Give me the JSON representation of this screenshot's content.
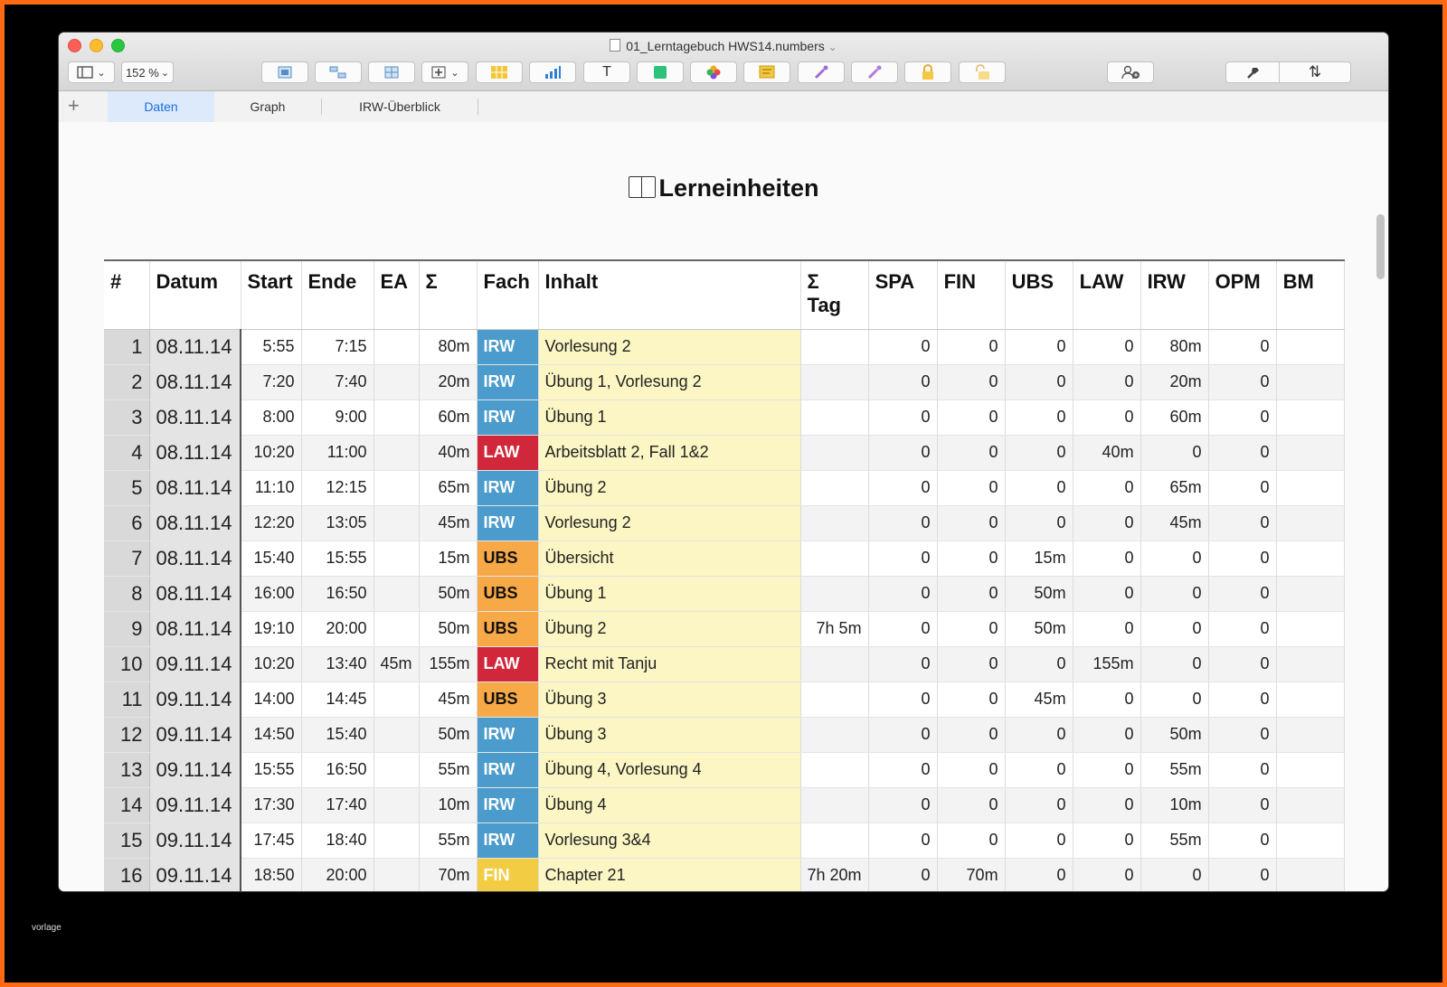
{
  "window": {
    "title": "01_Lerntagebuch HWS14.numbers",
    "title_chevron": "⌄"
  },
  "toolbar": {
    "zoom": "152 %",
    "zoom_caret": "⌄",
    "view_caret": "⌄",
    "icons": [
      "view-icon",
      "pivot-icon",
      "arrange-icon",
      "table-insert-icon",
      "add-column-icon",
      "table-icon",
      "chart-icon",
      "text-icon",
      "shape-icon",
      "media-icon",
      "comment-icon",
      "tint-icon",
      "collaborate-icon",
      "lock-icon",
      "unlock-icon",
      "share-icon",
      "format-icon",
      "sort-icon"
    ],
    "text_tool": "T",
    "sort_tool": "⇅"
  },
  "tabs": {
    "add": "+",
    "items": [
      {
        "label": "Daten"
      },
      {
        "label": "Graph"
      },
      {
        "label": "IRW-Überblick"
      }
    ]
  },
  "sheet": {
    "title": "Lerneinheiten"
  },
  "table": {
    "headers": [
      "#",
      "Datum",
      "Start",
      "Ende",
      "EA",
      "Σ",
      "Fach",
      "Inhalt",
      "Σ Tag",
      "SPA",
      "FIN",
      "UBS",
      "LAW",
      "IRW",
      "OPM",
      "BM"
    ],
    "rows": [
      {
        "n": "1",
        "datum": "08.11.14",
        "start": "5:55",
        "ende": "7:15",
        "ea": "",
        "sum": "80m",
        "fach": "IRW",
        "inhalt": "Vorlesung 2",
        "tag": "",
        "spa": "0",
        "fin": "0",
        "ubs": "0",
        "law": "0",
        "irw": "80m",
        "opm": "0",
        "bm": ""
      },
      {
        "n": "2",
        "datum": "08.11.14",
        "start": "7:20",
        "ende": "7:40",
        "ea": "",
        "sum": "20m",
        "fach": "IRW",
        "inhalt": "Übung 1, Vorlesung 2",
        "tag": "",
        "spa": "0",
        "fin": "0",
        "ubs": "0",
        "law": "0",
        "irw": "20m",
        "opm": "0",
        "bm": ""
      },
      {
        "n": "3",
        "datum": "08.11.14",
        "start": "8:00",
        "ende": "9:00",
        "ea": "",
        "sum": "60m",
        "fach": "IRW",
        "inhalt": "Übung 1",
        "tag": "",
        "spa": "0",
        "fin": "0",
        "ubs": "0",
        "law": "0",
        "irw": "60m",
        "opm": "0",
        "bm": ""
      },
      {
        "n": "4",
        "datum": "08.11.14",
        "start": "10:20",
        "ende": "11:00",
        "ea": "",
        "sum": "40m",
        "fach": "LAW",
        "inhalt": "Arbeitsblatt 2, Fall 1&2",
        "tag": "",
        "spa": "0",
        "fin": "0",
        "ubs": "0",
        "law": "40m",
        "irw": "0",
        "opm": "0",
        "bm": ""
      },
      {
        "n": "5",
        "datum": "08.11.14",
        "start": "11:10",
        "ende": "12:15",
        "ea": "",
        "sum": "65m",
        "fach": "IRW",
        "inhalt": "Übung 2",
        "tag": "",
        "spa": "0",
        "fin": "0",
        "ubs": "0",
        "law": "0",
        "irw": "65m",
        "opm": "0",
        "bm": ""
      },
      {
        "n": "6",
        "datum": "08.11.14",
        "start": "12:20",
        "ende": "13:05",
        "ea": "",
        "sum": "45m",
        "fach": "IRW",
        "inhalt": "Vorlesung 2",
        "tag": "",
        "spa": "0",
        "fin": "0",
        "ubs": "0",
        "law": "0",
        "irw": "45m",
        "opm": "0",
        "bm": ""
      },
      {
        "n": "7",
        "datum": "08.11.14",
        "start": "15:40",
        "ende": "15:55",
        "ea": "",
        "sum": "15m",
        "fach": "UBS",
        "inhalt": "Übersicht",
        "tag": "",
        "spa": "0",
        "fin": "0",
        "ubs": "15m",
        "law": "0",
        "irw": "0",
        "opm": "0",
        "bm": ""
      },
      {
        "n": "8",
        "datum": "08.11.14",
        "start": "16:00",
        "ende": "16:50",
        "ea": "",
        "sum": "50m",
        "fach": "UBS",
        "inhalt": "Übung 1",
        "tag": "",
        "spa": "0",
        "fin": "0",
        "ubs": "50m",
        "law": "0",
        "irw": "0",
        "opm": "0",
        "bm": ""
      },
      {
        "n": "9",
        "datum": "08.11.14",
        "start": "19:10",
        "ende": "20:00",
        "ea": "",
        "sum": "50m",
        "fach": "UBS",
        "inhalt": "Übung 2",
        "tag": "7h 5m",
        "spa": "0",
        "fin": "0",
        "ubs": "50m",
        "law": "0",
        "irw": "0",
        "opm": "0",
        "bm": ""
      },
      {
        "n": "10",
        "datum": "09.11.14",
        "start": "10:20",
        "ende": "13:40",
        "ea": "45m",
        "sum": "155m",
        "fach": "LAW",
        "inhalt": "Recht mit Tanju",
        "tag": "",
        "spa": "0",
        "fin": "0",
        "ubs": "0",
        "law": "155m",
        "irw": "0",
        "opm": "0",
        "bm": ""
      },
      {
        "n": "11",
        "datum": "09.11.14",
        "start": "14:00",
        "ende": "14:45",
        "ea": "",
        "sum": "45m",
        "fach": "UBS",
        "inhalt": "Übung 3",
        "tag": "",
        "spa": "0",
        "fin": "0",
        "ubs": "45m",
        "law": "0",
        "irw": "0",
        "opm": "0",
        "bm": ""
      },
      {
        "n": "12",
        "datum": "09.11.14",
        "start": "14:50",
        "ende": "15:40",
        "ea": "",
        "sum": "50m",
        "fach": "IRW",
        "inhalt": "Übung 3",
        "tag": "",
        "spa": "0",
        "fin": "0",
        "ubs": "0",
        "law": "0",
        "irw": "50m",
        "opm": "0",
        "bm": ""
      },
      {
        "n": "13",
        "datum": "09.11.14",
        "start": "15:55",
        "ende": "16:50",
        "ea": "",
        "sum": "55m",
        "fach": "IRW",
        "inhalt": "Übung 4, Vorlesung 4",
        "tag": "",
        "spa": "0",
        "fin": "0",
        "ubs": "0",
        "law": "0",
        "irw": "55m",
        "opm": "0",
        "bm": ""
      },
      {
        "n": "14",
        "datum": "09.11.14",
        "start": "17:30",
        "ende": "17:40",
        "ea": "",
        "sum": "10m",
        "fach": "IRW",
        "inhalt": "Übung 4",
        "tag": "",
        "spa": "0",
        "fin": "0",
        "ubs": "0",
        "law": "0",
        "irw": "10m",
        "opm": "0",
        "bm": ""
      },
      {
        "n": "15",
        "datum": "09.11.14",
        "start": "17:45",
        "ende": "18:40",
        "ea": "",
        "sum": "55m",
        "fach": "IRW",
        "inhalt": "Vorlesung 3&4",
        "tag": "",
        "spa": "0",
        "fin": "0",
        "ubs": "0",
        "law": "0",
        "irw": "55m",
        "opm": "0",
        "bm": ""
      },
      {
        "n": "16",
        "datum": "09.11.14",
        "start": "18:50",
        "ende": "20:00",
        "ea": "",
        "sum": "70m",
        "fach": "FIN",
        "inhalt": "Chapter 21",
        "tag": "7h 20m",
        "spa": "0",
        "fin": "70m",
        "ubs": "0",
        "law": "0",
        "irw": "0",
        "opm": "0",
        "bm": ""
      }
    ]
  },
  "colors": {
    "IRW": "#4b9bcc",
    "LAW": "#d0283a",
    "UBS": "#f8a947",
    "FIN": "#f2cd44",
    "inhalt_bg": "#fbf6c3",
    "frame": "#ff6a13",
    "tab_active": "#1a6ee0"
  },
  "watermark": "vorlage"
}
